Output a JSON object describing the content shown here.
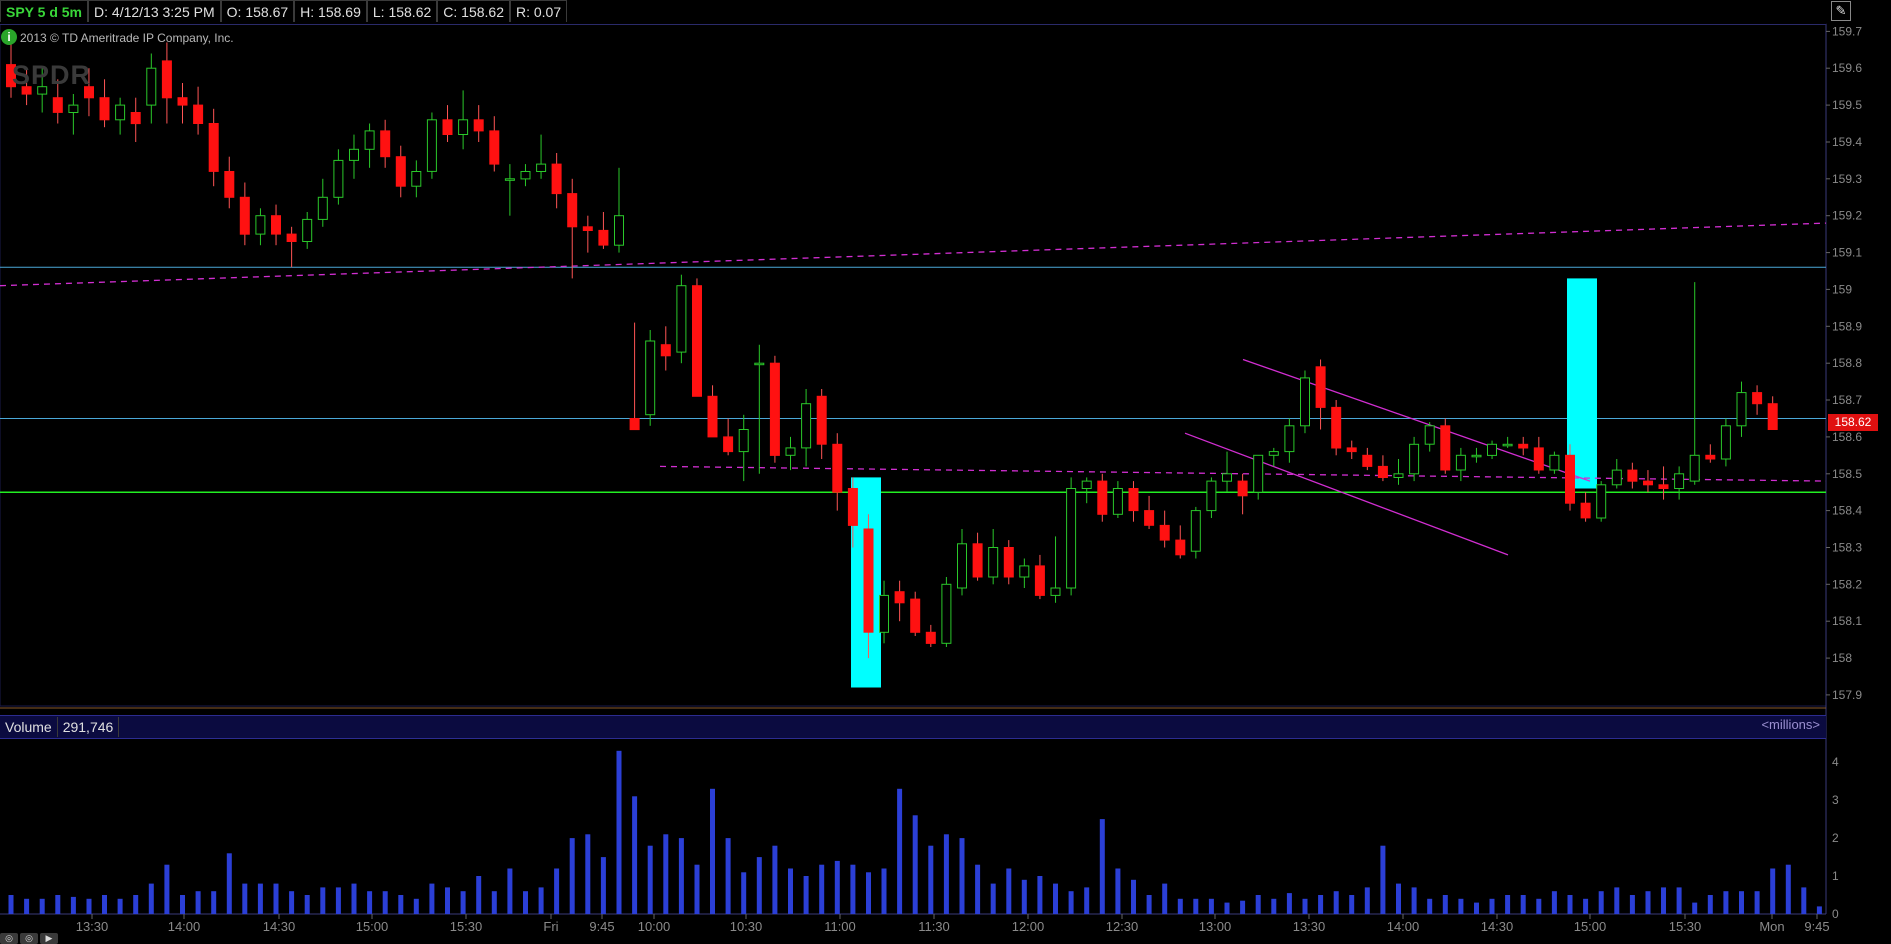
{
  "header": {
    "symbol": "SPY 5 d 5m",
    "date": "D: 4/12/13 3:25 PM",
    "open": "O: 158.67",
    "high": "H: 158.69",
    "low": "L: 158.62",
    "close": "C: 158.62",
    "range": "R: 0.07"
  },
  "copyright": "2013 © TD Ameritrade IP Company, Inc.",
  "watermark": "SPDR",
  "last_price": "158.62",
  "volume_header": {
    "label": "Volume",
    "value": "291,746",
    "unit": "<millions>"
  },
  "colors": {
    "up": "#2ac82a",
    "down": "#ff1111",
    "volume": "#2b3fd6",
    "highlight": "#00ffff",
    "trend": "#d12ed1",
    "hline": "#4aa8d8",
    "support": "#22ee22"
  },
  "chart_data": {
    "type": "candlestick",
    "price_axis": {
      "ylim": [
        157.87,
        159.72
      ],
      "ticks": [
        159.7,
        159.6,
        159.5,
        159.4,
        159.3,
        159.2,
        159.1,
        159,
        158.9,
        158.8,
        158.7,
        158.6,
        158.5,
        158.4,
        158.3,
        158.2,
        158.1,
        158,
        157.9
      ]
    },
    "volume_axis": {
      "ylim": [
        0,
        4.4
      ],
      "ticks": [
        "4",
        "3",
        "2",
        "1",
        "0"
      ],
      "unit": "millions"
    },
    "time_labels": [
      "13:30",
      "14:00",
      "14:30",
      "15:00",
      "15:30",
      "Fri",
      "9:45",
      "10:00",
      "10:30",
      "11:00",
      "11:30",
      "12:00",
      "12:30",
      "13:00",
      "13:30",
      "14:00",
      "14:30",
      "15:00",
      "15:30",
      "Mon",
      "9:45"
    ],
    "candles": [
      [
        159.61,
        159.67,
        159.52,
        159.55
      ],
      [
        159.55,
        159.6,
        159.5,
        159.53
      ],
      [
        159.53,
        159.6,
        159.48,
        159.55
      ],
      [
        159.52,
        159.57,
        159.45,
        159.48
      ],
      [
        159.48,
        159.53,
        159.42,
        159.5
      ],
      [
        159.55,
        159.6,
        159.47,
        159.52
      ],
      [
        159.52,
        159.57,
        159.44,
        159.46
      ],
      [
        159.46,
        159.52,
        159.42,
        159.5
      ],
      [
        159.48,
        159.52,
        159.4,
        159.45
      ],
      [
        159.5,
        159.64,
        159.45,
        159.6
      ],
      [
        159.62,
        159.67,
        159.45,
        159.52
      ],
      [
        159.52,
        159.56,
        159.45,
        159.5
      ],
      [
        159.5,
        159.55,
        159.42,
        159.45
      ],
      [
        159.45,
        159.49,
        159.28,
        159.32
      ],
      [
        159.32,
        159.36,
        159.22,
        159.25
      ],
      [
        159.25,
        159.29,
        159.12,
        159.15
      ],
      [
        159.15,
        159.22,
        159.12,
        159.2
      ],
      [
        159.2,
        159.23,
        159.12,
        159.15
      ],
      [
        159.15,
        159.17,
        159.06,
        159.13
      ],
      [
        159.13,
        159.21,
        159.11,
        159.19
      ],
      [
        159.19,
        159.3,
        159.17,
        159.25
      ],
      [
        159.25,
        159.38,
        159.23,
        159.35
      ],
      [
        159.35,
        159.42,
        159.3,
        159.38
      ],
      [
        159.38,
        159.45,
        159.33,
        159.43
      ],
      [
        159.43,
        159.46,
        159.33,
        159.36
      ],
      [
        159.36,
        159.39,
        159.25,
        159.28
      ],
      [
        159.28,
        159.35,
        159.25,
        159.32
      ],
      [
        159.32,
        159.48,
        159.3,
        159.46
      ],
      [
        159.46,
        159.5,
        159.4,
        159.42
      ],
      [
        159.42,
        159.54,
        159.38,
        159.46
      ],
      [
        159.46,
        159.5,
        159.4,
        159.43
      ],
      [
        159.43,
        159.47,
        159.32,
        159.34
      ],
      [
        159.3,
        159.34,
        159.2,
        159.3
      ],
      [
        159.3,
        159.34,
        159.28,
        159.32
      ],
      [
        159.32,
        159.42,
        159.3,
        159.34
      ],
      [
        159.34,
        159.37,
        159.22,
        159.26
      ],
      [
        159.26,
        159.3,
        159.03,
        159.17
      ],
      [
        159.17,
        159.2,
        159.1,
        159.16
      ],
      [
        159.16,
        159.21,
        159.11,
        159.12
      ],
      [
        159.12,
        159.33,
        159.1,
        159.2
      ],
      [
        158.65,
        158.91,
        158.63,
        158.62
      ],
      [
        158.66,
        158.89,
        158.63,
        158.86
      ],
      [
        158.85,
        158.9,
        158.78,
        158.82
      ],
      [
        158.83,
        159.04,
        158.8,
        159.01
      ],
      [
        159.01,
        159.03,
        158.71,
        158.71
      ],
      [
        158.71,
        158.74,
        158.6,
        158.6
      ],
      [
        158.6,
        158.65,
        158.55,
        158.56
      ],
      [
        158.56,
        158.66,
        158.48,
        158.62
      ],
      [
        158.8,
        158.85,
        158.5,
        158.8
      ],
      [
        158.8,
        158.82,
        158.53,
        158.55
      ],
      [
        158.55,
        158.6,
        158.51,
        158.57
      ],
      [
        158.57,
        158.73,
        158.52,
        158.69
      ],
      [
        158.71,
        158.73,
        158.54,
        158.58
      ],
      [
        158.58,
        158.61,
        158.4,
        158.45
      ],
      [
        158.46,
        158.49,
        158.3,
        158.36
      ],
      [
        158.35,
        158.39,
        158.0,
        158.07
      ],
      [
        158.07,
        158.21,
        158.04,
        158.17
      ],
      [
        158.18,
        158.21,
        158.1,
        158.15
      ],
      [
        158.16,
        158.18,
        158.06,
        158.07
      ],
      [
        158.07,
        158.09,
        158.03,
        158.04
      ],
      [
        158.04,
        158.22,
        158.03,
        158.2
      ],
      [
        158.19,
        158.35,
        158.17,
        158.31
      ],
      [
        158.31,
        158.34,
        158.21,
        158.22
      ],
      [
        158.22,
        158.35,
        158.2,
        158.3
      ],
      [
        158.3,
        158.32,
        158.2,
        158.22
      ],
      [
        158.22,
        158.27,
        158.19,
        158.25
      ],
      [
        158.25,
        158.28,
        158.16,
        158.17
      ],
      [
        158.17,
        158.33,
        158.15,
        158.19
      ],
      [
        158.19,
        158.49,
        158.17,
        158.46
      ],
      [
        158.46,
        158.49,
        158.42,
        158.48
      ],
      [
        158.48,
        158.5,
        158.37,
        158.39
      ],
      [
        158.39,
        158.48,
        158.38,
        158.46
      ],
      [
        158.46,
        158.48,
        158.37,
        158.4
      ],
      [
        158.4,
        158.44,
        158.35,
        158.36
      ],
      [
        158.36,
        158.4,
        158.3,
        158.32
      ],
      [
        158.32,
        158.36,
        158.27,
        158.28
      ],
      [
        158.29,
        158.41,
        158.27,
        158.4
      ],
      [
        158.4,
        158.49,
        158.38,
        158.48
      ],
      [
        158.48,
        158.56,
        158.45,
        158.5
      ],
      [
        158.48,
        158.5,
        158.39,
        158.44
      ],
      [
        158.45,
        158.55,
        158.43,
        158.55
      ],
      [
        158.55,
        158.57,
        158.52,
        158.56
      ],
      [
        158.56,
        158.65,
        158.53,
        158.63
      ],
      [
        158.63,
        158.78,
        158.61,
        158.76
      ],
      [
        158.79,
        158.81,
        158.62,
        158.68
      ],
      [
        158.68,
        158.7,
        158.55,
        158.57
      ],
      [
        158.57,
        158.59,
        158.54,
        158.56
      ],
      [
        158.55,
        158.57,
        158.51,
        158.52
      ],
      [
        158.52,
        158.55,
        158.48,
        158.49
      ],
      [
        158.49,
        158.54,
        158.47,
        158.5
      ],
      [
        158.5,
        158.6,
        158.48,
        158.58
      ],
      [
        158.58,
        158.64,
        158.56,
        158.63
      ],
      [
        158.63,
        158.65,
        158.5,
        158.51
      ],
      [
        158.51,
        158.57,
        158.48,
        158.55
      ],
      [
        158.55,
        158.57,
        158.53,
        158.55
      ],
      [
        158.55,
        158.59,
        158.54,
        158.58
      ],
      [
        158.58,
        158.6,
        158.57,
        158.58
      ],
      [
        158.58,
        158.6,
        158.55,
        158.57
      ],
      [
        158.57,
        158.6,
        158.5,
        158.51
      ],
      [
        158.51,
        158.56,
        158.5,
        158.55
      ],
      [
        158.55,
        158.58,
        158.4,
        158.42
      ],
      [
        158.42,
        158.45,
        158.37,
        158.38
      ],
      [
        158.38,
        158.48,
        158.37,
        158.47
      ],
      [
        158.47,
        158.54,
        158.46,
        158.51
      ],
      [
        158.51,
        158.53,
        158.46,
        158.48
      ],
      [
        158.48,
        158.51,
        158.45,
        158.47
      ],
      [
        158.47,
        158.52,
        158.43,
        158.46
      ],
      [
        158.46,
        158.52,
        158.43,
        158.5
      ],
      [
        158.48,
        159.02,
        158.47,
        158.55
      ],
      [
        158.55,
        158.58,
        158.53,
        158.54
      ],
      [
        158.54,
        158.65,
        158.52,
        158.63
      ],
      [
        158.63,
        158.75,
        158.6,
        158.72
      ],
      [
        158.72,
        158.74,
        158.66,
        158.69
      ],
      [
        158.69,
        158.71,
        158.62,
        158.62
      ]
    ],
    "volume": [
      0.5,
      0.4,
      0.4,
      0.5,
      0.45,
      0.4,
      0.5,
      0.4,
      0.5,
      0.8,
      1.3,
      0.5,
      0.6,
      0.6,
      1.6,
      0.8,
      0.8,
      0.8,
      0.6,
      0.5,
      0.7,
      0.7,
      0.8,
      0.6,
      0.6,
      0.5,
      0.4,
      0.8,
      0.7,
      0.6,
      1.0,
      0.6,
      1.2,
      0.6,
      0.7,
      1.2,
      2.0,
      2.1,
      1.5,
      4.3,
      3.1,
      1.8,
      2.1,
      2.0,
      1.3,
      3.3,
      2.0,
      1.1,
      1.5,
      1.8,
      1.2,
      1.0,
      1.3,
      1.4,
      1.3,
      1.1,
      1.2,
      3.3,
      2.6,
      1.8,
      2.1,
      2.0,
      1.3,
      0.8,
      1.2,
      0.9,
      1.0,
      0.8,
      0.6,
      0.7,
      2.5,
      1.2,
      0.9,
      0.5,
      0.8,
      0.4,
      0.4,
      0.4,
      0.3,
      0.35,
      0.5,
      0.4,
      0.55,
      0.4,
      0.5,
      0.6,
      0.5,
      0.7,
      1.8,
      0.8,
      0.7,
      0.4,
      0.5,
      0.4,
      0.3,
      0.4,
      0.5,
      0.5,
      0.4,
      0.6,
      0.5,
      0.4,
      0.6,
      0.7,
      0.5,
      0.6,
      0.7,
      0.7,
      0.3,
      0.5,
      0.6,
      0.6,
      0.6,
      1.2,
      1.3,
      0.7,
      0.2
    ],
    "horizontal_lines": [
      159.06,
      158.65,
      158.45
    ],
    "highlight_bars": [
      [
        158.49,
        157.92
      ],
      [
        159.03,
        158.46
      ]
    ],
    "trend_lines": [
      [
        159.01,
        159.18
      ],
      [
        158.52,
        158.48
      ],
      [
        158.81,
        158.48
      ],
      [
        158.61,
        158.28
      ]
    ]
  }
}
